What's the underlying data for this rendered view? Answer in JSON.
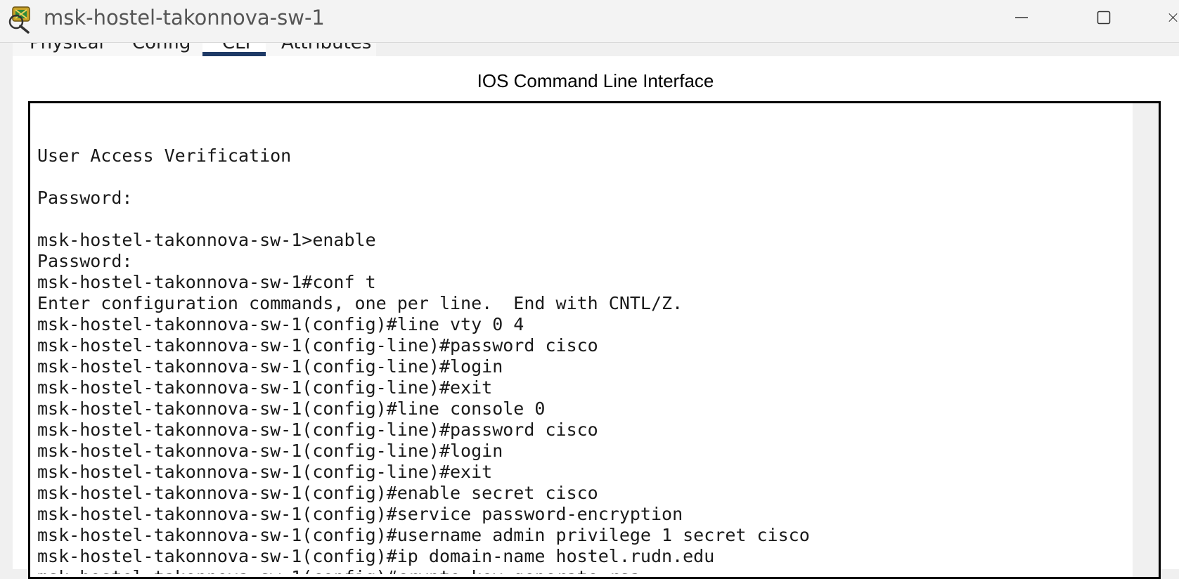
{
  "window": {
    "title": "msk-hostel-takonnova-sw-1"
  },
  "tabs": [
    {
      "label": "Physical"
    },
    {
      "label": "Config"
    },
    {
      "label": "CLI"
    },
    {
      "label": "Attributes"
    }
  ],
  "cli": {
    "heading": "IOS Command Line Interface",
    "output": "\nUser Access Verification\n\nPassword:\n\nmsk-hostel-takonnova-sw-1>enable\nPassword:\nmsk-hostel-takonnova-sw-1#conf t\nEnter configuration commands, one per line.  End with CNTL/Z.\nmsk-hostel-takonnova-sw-1(config)#line vty 0 4\nmsk-hostel-takonnova-sw-1(config-line)#password cisco\nmsk-hostel-takonnova-sw-1(config-line)#login\nmsk-hostel-takonnova-sw-1(config-line)#exit\nmsk-hostel-takonnova-sw-1(config)#line console 0\nmsk-hostel-takonnova-sw-1(config-line)#password cisco\nmsk-hostel-takonnova-sw-1(config-line)#login\nmsk-hostel-takonnova-sw-1(config-line)#exit\nmsk-hostel-takonnova-sw-1(config)#enable secret cisco\nmsk-hostel-takonnova-sw-1(config)#service password-encryption\nmsk-hostel-takonnova-sw-1(config)#username admin privilege 1 secret cisco\nmsk-hostel-takonnova-sw-1(config)#ip domain-name hostel.rudn.edu\nmsk-hostel-takonnova-sw-1(config)#crypto key generate rsa"
  },
  "icons": {
    "app": "packet-tracer-icon",
    "minimize": "minimize-icon",
    "maximize": "maximize-icon",
    "close": "close-icon"
  },
  "colors": {
    "active_tab_indicator": "#1e3a66",
    "terminal_border": "#000000",
    "terminal_text": "#1a1a1a"
  }
}
